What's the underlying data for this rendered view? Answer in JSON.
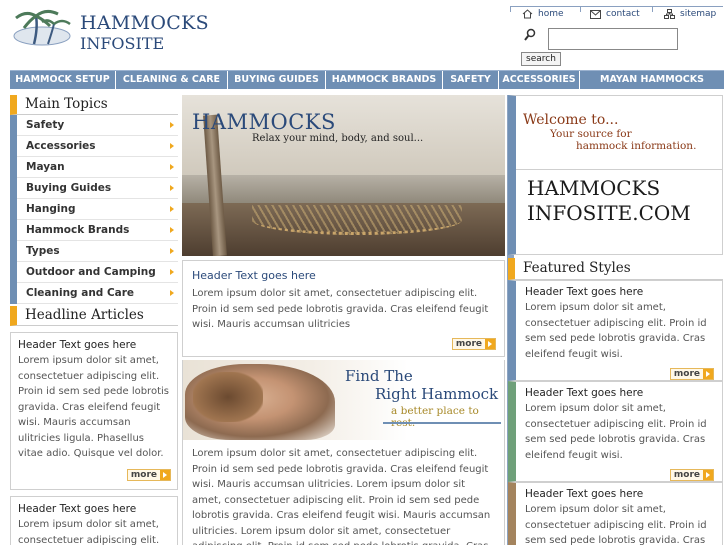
{
  "header": {
    "logo_line1": "HAMMOCKS",
    "logo_line2": "INFOSITE",
    "toplinks": [
      {
        "label": "home",
        "icon": "home-icon"
      },
      {
        "label": "contact",
        "icon": "envelope-icon"
      },
      {
        "label": "sitemap",
        "icon": "sitemap-icon"
      }
    ],
    "search_button": "search",
    "search_value": ""
  },
  "nav": {
    "items": [
      "HAMMOCK SETUP",
      "CLEANING & CARE",
      "BUYING GUIDES",
      "HAMMOCK BRANDS",
      "SAFETY",
      "ACCESSORIES",
      "MAYAN HAMMOCKS"
    ]
  },
  "left": {
    "main_topics_title": "Main Topics",
    "topics": [
      "Safety",
      "Accessories",
      "Mayan",
      "Buying Guides",
      "Hanging",
      "Hammock Brands",
      "Types",
      "Outdoor and Camping",
      "Cleaning and Care"
    ],
    "headline_title": "Headline Articles",
    "articles": [
      {
        "title": "Header Text goes here",
        "body": "Lorem ipsum dolor sit amet, consectetuer adipiscing elit. Proin id sem sed pede lobrotis gravida. Cras eleifend feugit wisi. Mauris accumsan ulitricies ligula. Phasellus vitae adio. Quisque vel dolor.",
        "more": "more"
      },
      {
        "title": "Header Text goes here",
        "body": "Lorem ipsum dolor sit amet, consectetuer adipiscing elit. Proin id sem sed pede lobrotis"
      }
    ]
  },
  "center": {
    "hero_title": "HAMMOCKS",
    "hero_subtitle": "Relax your mind, body, and soul...",
    "box1": {
      "title": "Header Text goes here",
      "body": "Lorem ipsum dolor sit amet, consectetuer adipiscing elit. Proin id sem sed pede lobrotis gravida. Cras eleifend feugit wisi. Mauris accumsan ulitricies",
      "more": "more"
    },
    "find": {
      "line1": "Find The",
      "line2": "Right Hammock",
      "line3": "a better place to rest."
    },
    "box2": {
      "body": "Lorem ipsum dolor sit amet, consectetuer adipiscing elit. Proin id sem sed pede lobrotis gravida. Cras eleifend feugit wisi. Mauris accumsan ulitricies. Lorem ipsum dolor sit amet, consectetuer adipiscing elit. Proin id sem sed pede lobrotis gravida. Cras eleifend feugit wisi. Mauris accumsan ulitricies. Lorem ipsum dolor sit amet, consectetuer adipiscing elit. Proin id sem sed pede lobrotis gravida. Cras eleifend feugit wisi,"
    }
  },
  "right": {
    "welcome_line1": "Welcome to...",
    "welcome_line2": "Your source for",
    "welcome_line3": "hammock information.",
    "site_line1": "HAMMOCKS",
    "site_line2": "INFOSITE.COM",
    "featured_title": "Featured Styles",
    "featured": [
      {
        "title": "Header Text goes here",
        "body": "Lorem ipsum dolor sit amet, consectetuer adipiscing elit. Proin id sem sed pede lobrotis gravida. Cras eleifend feugit wisi.",
        "more": "more"
      },
      {
        "title": "Header Text goes here",
        "body": "Lorem ipsum dolor sit amet, consectetuer adipiscing elit. Proin id sem sed pede lobrotis gravida. Cras eleifend feugit wisi.",
        "more": "more"
      },
      {
        "title": "Header Text goes here",
        "body": "Lorem ipsum dolor sit amet, consectetuer adipiscing elit. Proin id sem sed pede lobrotis gravida. Cras eleifend feugit wisi."
      }
    ]
  },
  "colors": {
    "accent_orange": "#f0a81e",
    "nav_blue": "#6f8fb4",
    "brand_blue": "#2b4a7a",
    "welcome_brown": "#8a3a18"
  }
}
